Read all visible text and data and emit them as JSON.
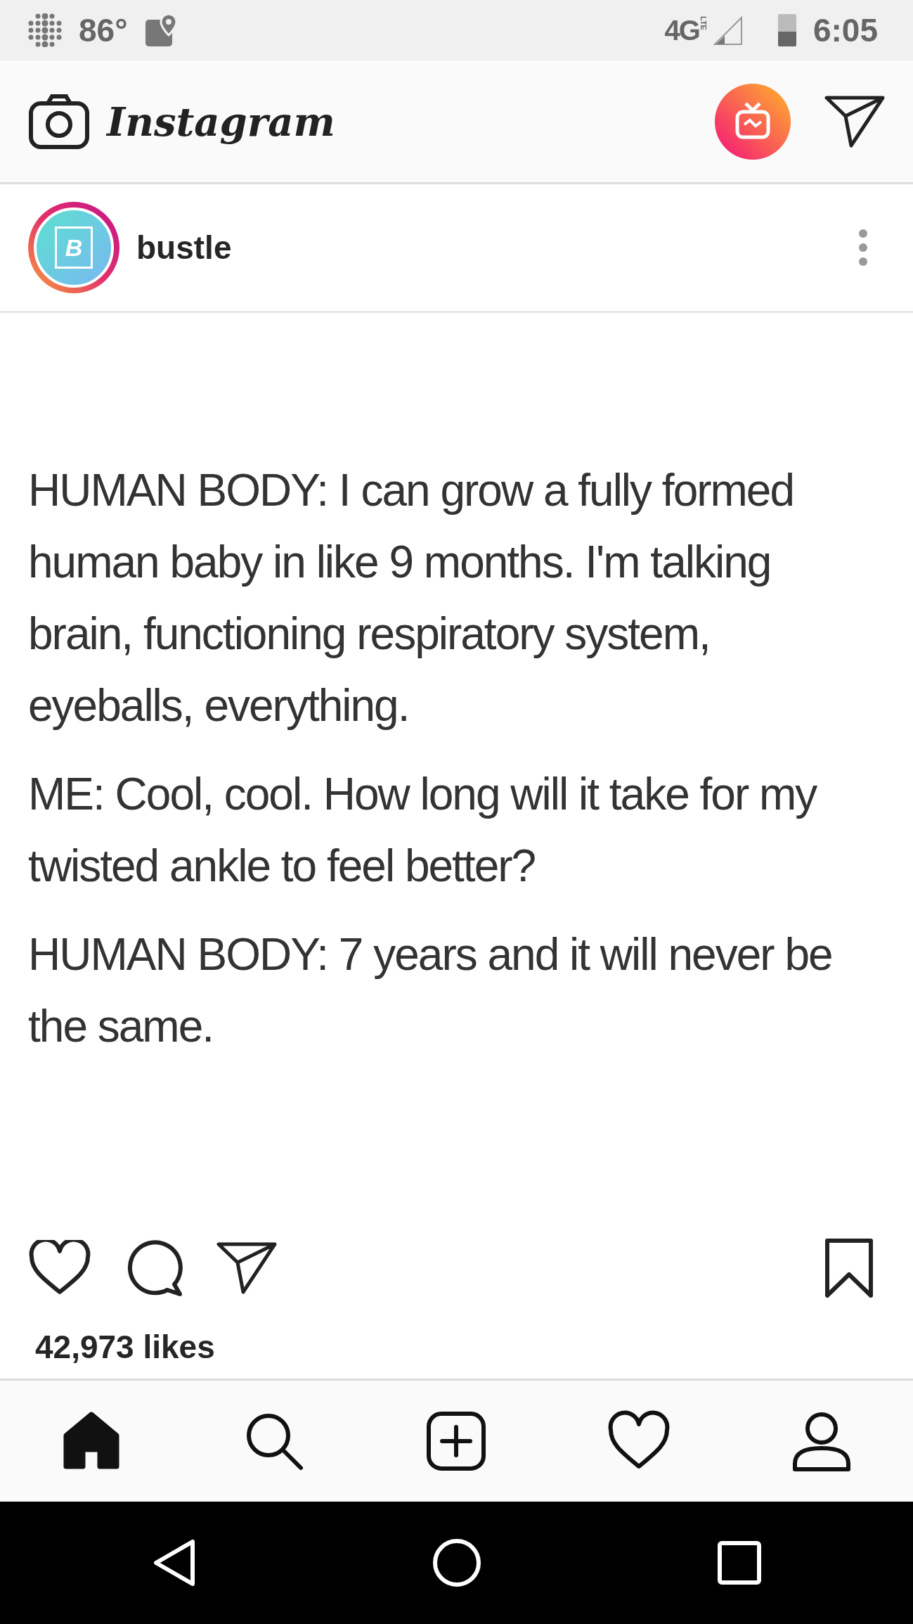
{
  "status_bar": {
    "temperature": "86°",
    "network": "4G",
    "network_sub": "LTE",
    "time": "6:05"
  },
  "header": {
    "title": "Instagram"
  },
  "post": {
    "username": "bustle",
    "avatar_letter": "B",
    "has_story": true,
    "content": [
      "HUMAN BODY: I can grow a fully formed human baby in like 9 months. I'm talking brain, functioning respiratory system, eyeballs, everything.",
      "ME: Cool, cool. How long will it take for my twisted ankle to feel better?",
      "HUMAN BODY: 7 years and it will never be the same."
    ],
    "liked": false,
    "saved": false,
    "likes": "42,973 likes"
  },
  "bottom_nav": [
    {
      "kind": "home",
      "selected": true
    },
    {
      "kind": "search",
      "selected": false
    },
    {
      "kind": "add",
      "selected": false
    },
    {
      "kind": "heart",
      "selected": false
    },
    {
      "kind": "profile",
      "selected": false
    }
  ]
}
